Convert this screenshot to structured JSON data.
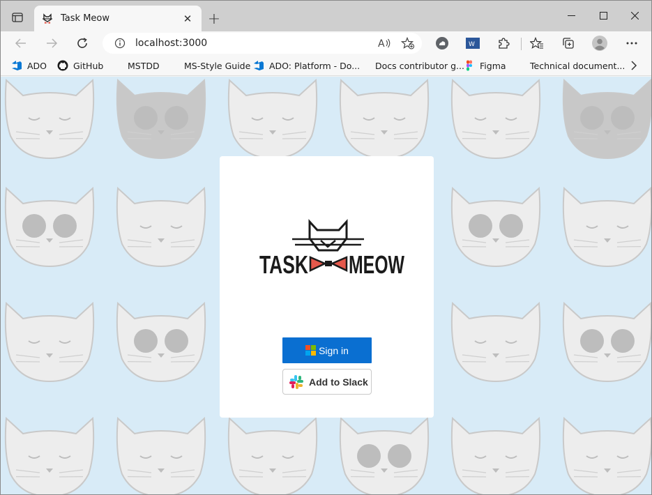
{
  "browser": {
    "tab": {
      "title": "Task Meow",
      "close_glyph": "✕"
    },
    "new_tab_glyph": "+",
    "address": {
      "url": "localhost:3000"
    },
    "bookmarks": [
      {
        "label": "ADO",
        "icon": "azure-devops-icon"
      },
      {
        "label": "GitHub",
        "icon": "github-icon"
      },
      {
        "label": "MSTDD",
        "icon": "microsoft-logo-icon"
      },
      {
        "label": "MS-Style Guide",
        "icon": "microsoft-logo-icon"
      },
      {
        "label": "ADO: Platform - Do...",
        "icon": "azure-devops-icon"
      },
      {
        "label": "Docs contributor g...",
        "icon": "microsoft-logo-icon"
      },
      {
        "label": "Figma",
        "icon": "figma-icon"
      },
      {
        "label": "Technical document...",
        "icon": "microsoft-logo-icon"
      }
    ]
  },
  "app": {
    "logo_text_left": "TASK",
    "logo_text_right": "MEOW",
    "signin_label": "Sign in",
    "slack_label": "Add to Slack"
  },
  "colors": {
    "accent_blue": "#0a6fd1",
    "background_blue": "#d8ebf7",
    "bowtie_red": "#e4584b",
    "ms_red": "#f25022",
    "ms_green": "#7fba00",
    "ms_blue": "#00a4ef",
    "ms_yellow": "#ffb900"
  }
}
